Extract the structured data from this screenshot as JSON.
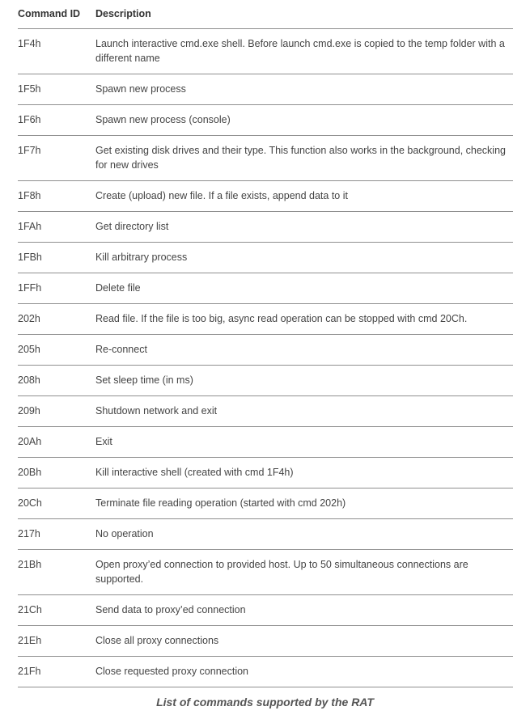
{
  "table": {
    "headers": [
      "Command ID",
      "Description"
    ],
    "rows": [
      {
        "id": "1F4h",
        "description": "Launch interactive cmd.exe shell. Before launch cmd.exe is copied to the temp folder with a different name"
      },
      {
        "id": "1F5h",
        "description": "Spawn new process"
      },
      {
        "id": "1F6h",
        "description": "Spawn new process (console)"
      },
      {
        "id": "1F7h",
        "description": "Get existing disk drives and their type. This function also works in the background, checking for new drives"
      },
      {
        "id": "1F8h",
        "description": "Create (upload) new file. If a file exists, append data to it"
      },
      {
        "id": "1FAh",
        "description": "Get directory list"
      },
      {
        "id": "1FBh",
        "description": "Kill arbitrary process"
      },
      {
        "id": "1FFh",
        "description": "Delete file"
      },
      {
        "id": "202h",
        "description": "Read file. If the file is too big, async read operation can be stopped with cmd 20Ch."
      },
      {
        "id": "205h",
        "description": "Re-connect"
      },
      {
        "id": "208h",
        "description": "Set sleep time (in ms)"
      },
      {
        "id": "209h",
        "description": "Shutdown network and exit"
      },
      {
        "id": "20Ah",
        "description": "Exit"
      },
      {
        "id": "20Bh",
        "description": "Kill interactive shell (created with cmd 1F4h)"
      },
      {
        "id": "20Ch",
        "description": "Terminate file reading operation (started with cmd 202h)"
      },
      {
        "id": "217h",
        "description": "No operation"
      },
      {
        "id": "21Bh",
        "description": "Open proxy’ed connection to provided host. Up to 50 simultaneous connections are supported."
      },
      {
        "id": "21Ch",
        "description": "Send data to proxy’ed connection"
      },
      {
        "id": "21Eh",
        "description": "Close all proxy connections"
      },
      {
        "id": "21Fh",
        "description": "Close requested proxy connection"
      }
    ]
  },
  "caption": "List of commands supported by the RAT"
}
